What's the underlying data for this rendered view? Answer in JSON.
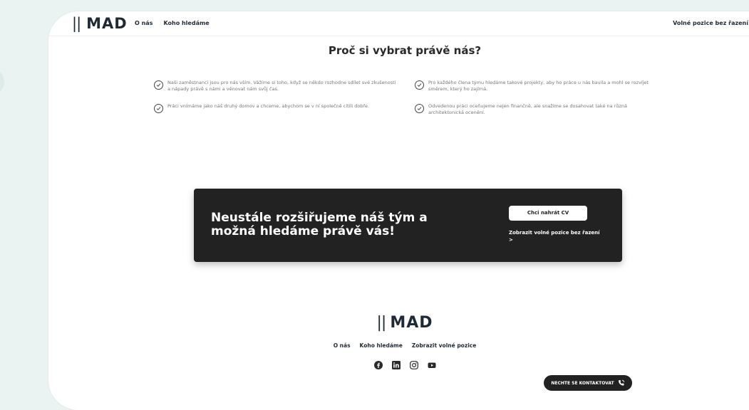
{
  "header": {
    "logo_bars": "||",
    "logo_text": "MAD",
    "nav": [
      "O nás",
      "Koho hledáme"
    ],
    "right_link": "Volné pozice bez řazení"
  },
  "section": {
    "title": "Proč si vybrat právě nás?",
    "benefits": [
      "Naši zaměstnanci jsou pro nás vším. Vážíme si toho, když se někdo rozhodne sdílet své zkušenosti a nápady právě s námi a věnovat nám svůj čas.",
      "Pro každého člena týmu hledáme takové projekty, aby ho práce u nás bavila a mohl se rozvíjet směrem, který ho zajímá.",
      "Práci vnímáme jako náš druhý domov a chceme, abychom se v ní společně cítili dobře.",
      "Odvedenou práci oceňujeme nejen finančně, ale snažíme se dosahovat také na různá architektonická ocenění."
    ]
  },
  "cta": {
    "heading": "Neustále rozšiřujeme náš tým a možná hledáme právě vás!",
    "button": "Chci nahrát CV",
    "link": "Zobrazit volné pozice bez řazení >"
  },
  "footer": {
    "logo_bars": "||",
    "logo_text": "MAD",
    "nav": [
      "O nás",
      "Koho hledáme",
      "Zobrazit volné pozice"
    ],
    "socials": [
      "facebook-icon",
      "linkedin-icon",
      "instagram-icon",
      "youtube-icon"
    ]
  },
  "contact_button": {
    "label": "NECHTE SE KONTAKTOVAT",
    "icon": "phone-icon"
  },
  "colors": {
    "background": "#eaf3f1",
    "dark": "#222222",
    "navy": "#1f2a36"
  }
}
